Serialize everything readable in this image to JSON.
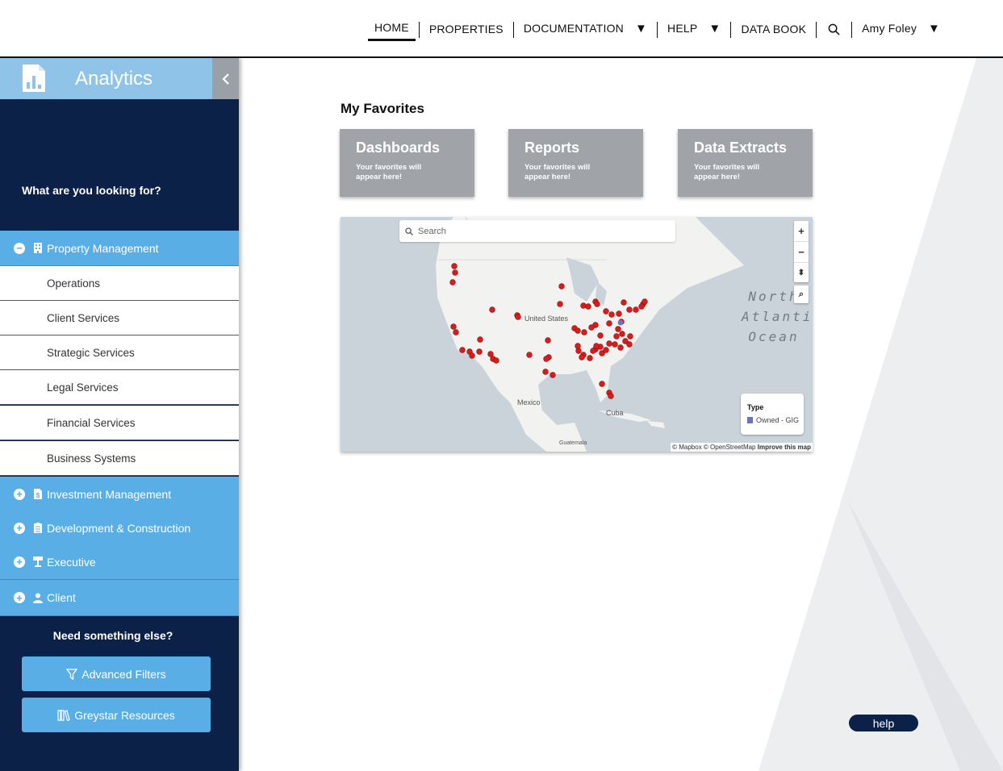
{
  "nav": {
    "home": "HOME",
    "properties": "PROPERTIES",
    "documentation": "DOCUMENTATION",
    "help": "HELP",
    "data_book": "DATA BOOK",
    "user": "Amy Foley"
  },
  "sidebar": {
    "title": "Analytics",
    "question": "What are you looking for?",
    "sections": [
      {
        "label": "Property Management",
        "toggle": "−",
        "icon": "building-icon",
        "expanded": true
      },
      {
        "label": "Investment Management",
        "toggle": "+",
        "icon": "document-dollar-icon",
        "expanded": false
      },
      {
        "label": "Development & Construction",
        "toggle": "+",
        "icon": "clipboard-icon",
        "expanded": false
      },
      {
        "label": "Executive",
        "toggle": "+",
        "icon": "podium-icon",
        "expanded": false
      },
      {
        "label": "Client",
        "toggle": "+",
        "icon": "client-icon",
        "expanded": false
      }
    ],
    "sub_items": [
      "Operations",
      "Client Services",
      "Strategic Services",
      "Legal Services",
      "Financial Services",
      "Business Systems"
    ],
    "need_else": "Need something else?",
    "advanced_filters": "Advanced Filters",
    "greystar_resources": "Greystar Resources"
  },
  "main": {
    "favorites_title": "My Favorites",
    "cards": [
      {
        "title": "Dashboards",
        "subtitle": "Your favorites will appear here!"
      },
      {
        "title": "Reports",
        "subtitle": "Your favorites will appear here!"
      },
      {
        "title": "Data Extracts",
        "subtitle": "Your favorites will appear here!"
      }
    ],
    "map": {
      "search_placeholder": "Search",
      "ocean_label": "North Atlantic Ocean",
      "label_us": "United States",
      "label_mexico": "Mexico",
      "label_cuba": "Cuba",
      "label_guatemala": "Guatemala",
      "legend_title": "Type",
      "legend_item": "Owned - GIG",
      "legend_color": "#6b72c4",
      "marker_color": "#d81c1c",
      "attribution": "© Mapbox © OpenStreetMap",
      "improve": "Improve this map"
    }
  },
  "help_button": "help",
  "colors": {
    "navy": "#0b2147",
    "accent_blue": "#5aaee6",
    "header_blue": "#8fc4e8",
    "card_gray": "#a0a3a8"
  }
}
